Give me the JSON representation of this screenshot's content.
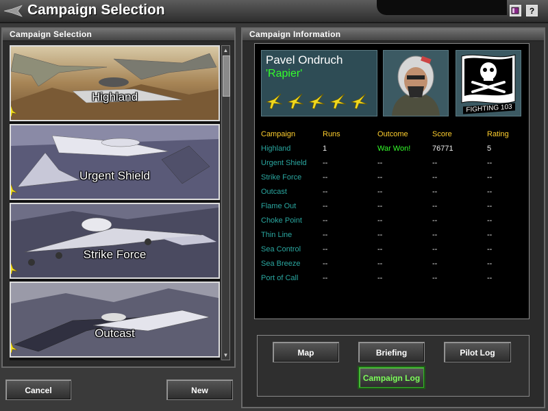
{
  "window": {
    "title": "Campaign Selection"
  },
  "left_panel": {
    "header": "Campaign Selection",
    "items": [
      {
        "label": "Highland"
      },
      {
        "label": "Urgent Shield"
      },
      {
        "label": "Strike Force"
      },
      {
        "label": "Outcast"
      }
    ],
    "buttons": {
      "cancel": "Cancel",
      "new": "New"
    }
  },
  "right_panel": {
    "header": "Campaign Information",
    "pilot": {
      "name": "Pavel Ondruch",
      "callsign": "'Rapier'",
      "rank_icons": 5,
      "patch_text": "FIGHTING 103"
    },
    "table": {
      "headers": [
        "Campaign",
        "Runs",
        "Outcome",
        "Score",
        "Rating"
      ],
      "rows": [
        [
          "Highland",
          "1",
          "War Won!",
          "76771",
          "5"
        ],
        [
          "Urgent Shield",
          "--",
          "--",
          "--",
          "--"
        ],
        [
          "Strike Force",
          "--",
          "--",
          "--",
          "--"
        ],
        [
          "Outcast",
          "--",
          "--",
          "--",
          "--"
        ],
        [
          "Flame Out",
          "--",
          "--",
          "--",
          "--"
        ],
        [
          "Choke Point",
          "--",
          "--",
          "--",
          "--"
        ],
        [
          "Thin Line",
          "--",
          "--",
          "--",
          "--"
        ],
        [
          "Sea Control",
          "--",
          "--",
          "--",
          "--"
        ],
        [
          "Sea Breeze",
          "--",
          "--",
          "--",
          "--"
        ],
        [
          "Port of Call",
          "--",
          "--",
          "--",
          "--"
        ]
      ]
    },
    "buttons": {
      "map": "Map",
      "briefing": "Briefing",
      "pilot_log": "Pilot Log",
      "campaign_log": "Campaign Log"
    }
  },
  "toolbar": {
    "help": "?"
  },
  "colors": {
    "header_text": "#ffcf2e",
    "campaign_text": "#2aa7a0",
    "callsign": "#34ff2b",
    "active_button": "#7dff5a"
  }
}
